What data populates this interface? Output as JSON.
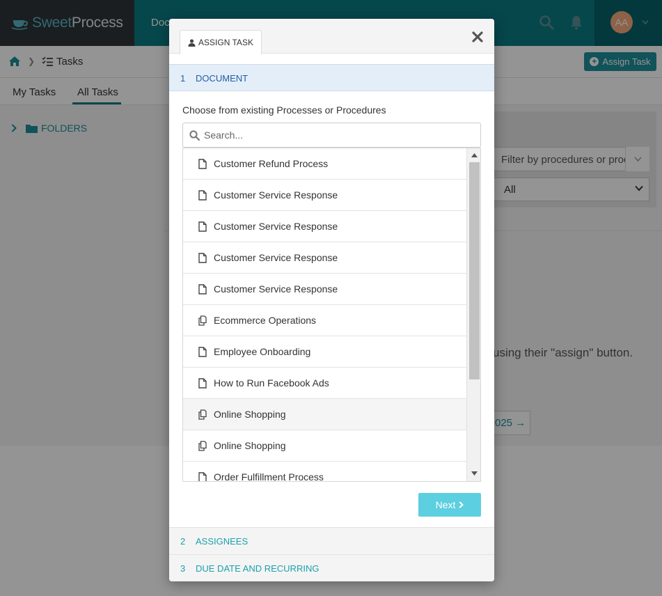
{
  "app": {
    "brand_part1": "Sweet",
    "brand_part2": "Process",
    "nav_documents": "Doc",
    "user_initials": "AA"
  },
  "breadcrumb": {
    "current": "Tasks"
  },
  "header": {
    "assign_task_label": "Assign Task"
  },
  "tabs": {
    "my_tasks": "My Tasks",
    "all_tasks": "All Tasks"
  },
  "sidebar": {
    "folders_label": "FOLDERS"
  },
  "filters": {
    "documents_placeholder": "Filter by procedures or proc",
    "status_value": "All"
  },
  "content": {
    "empty_message": "using their \"assign\" button.",
    "year_button": "025"
  },
  "modal": {
    "tab_label": "ASSIGN TASK",
    "steps": [
      {
        "number": "1",
        "label": "DOCUMENT"
      },
      {
        "number": "2",
        "label": "ASSIGNEES"
      },
      {
        "number": "3",
        "label": "DUE DATE AND RECURRING"
      }
    ],
    "choose_label": "Choose from existing Processes or Procedures",
    "search_placeholder": "Search...",
    "next_label": "Next",
    "documents": [
      {
        "label": "Customer Refund Process",
        "icon": "document-icon"
      },
      {
        "label": "Customer Service Response",
        "icon": "document-icon"
      },
      {
        "label": "Customer Service Response",
        "icon": "document-icon"
      },
      {
        "label": "Customer Service Response",
        "icon": "document-icon"
      },
      {
        "label": "Customer Service Response",
        "icon": "document-icon"
      },
      {
        "label": "Ecommerce Operations",
        "icon": "process-icon"
      },
      {
        "label": "Employee Onboarding",
        "icon": "document-icon"
      },
      {
        "label": "How to Run Facebook Ads",
        "icon": "document-icon"
      },
      {
        "label": "Online Shopping",
        "icon": "process-icon"
      },
      {
        "label": "Online Shopping",
        "icon": "process-icon"
      },
      {
        "label": "Order Fulfillment Process",
        "icon": "document-icon"
      }
    ]
  },
  "colors": {
    "topbar": "#0b7a84",
    "accent": "#1a8e99",
    "active_step_bg": "#e4eef8",
    "next_button": "#5ccfe0"
  }
}
